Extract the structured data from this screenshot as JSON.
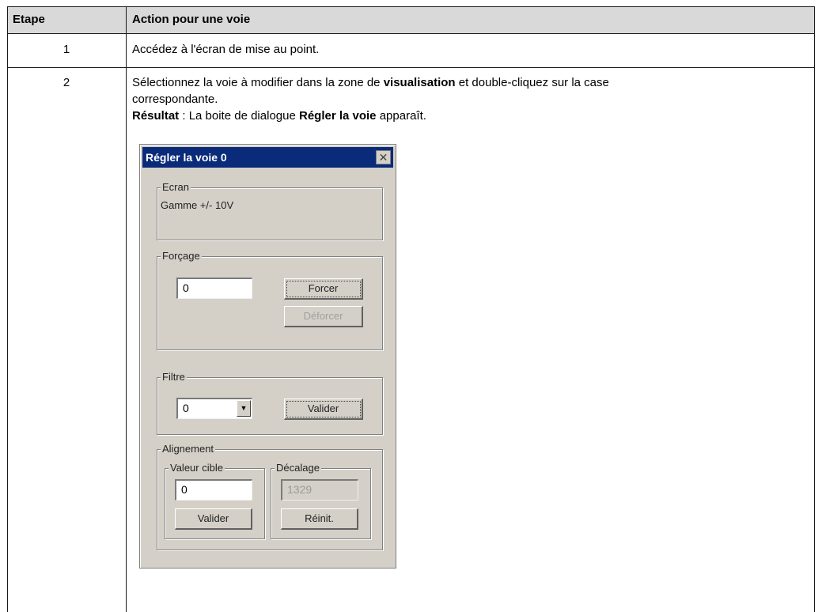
{
  "table": {
    "header": {
      "step": "Etape",
      "action": "Action pour une voie"
    },
    "rows": [
      {
        "step": "1",
        "text": "Accédez à l'écran de mise au point."
      },
      {
        "step": "2",
        "line1_pre": "Sélectionnez la voie à modifier dans la zone de ",
        "line1_bold": "visualisation",
        "line1_post": " et double-cliquez sur la case",
        "line2": "correspondante.",
        "result_label": "Résultat",
        "result_pre": " : La boite de dialogue ",
        "result_bold": "Régler la voie",
        "result_post": " apparaît."
      }
    ]
  },
  "dialog": {
    "title": "Régler la voie 0",
    "close_glyph": "✕",
    "ecran": {
      "label": "Ecran",
      "text": "Gamme +/- 10V"
    },
    "forcage": {
      "label": "Forçage",
      "value": "0",
      "force_button": "Forcer",
      "unforce_button": "Déforcer"
    },
    "filtre": {
      "label": "Filtre",
      "selected": "0",
      "arrow_glyph": "▼",
      "validate_button": "Valider"
    },
    "alignement": {
      "label": "Alignement",
      "target": {
        "label": "Valeur cible",
        "value": "0",
        "validate_button": "Valider"
      },
      "offset": {
        "label": "Décalage",
        "value": "1329",
        "reset_button": "Réinit."
      }
    }
  }
}
